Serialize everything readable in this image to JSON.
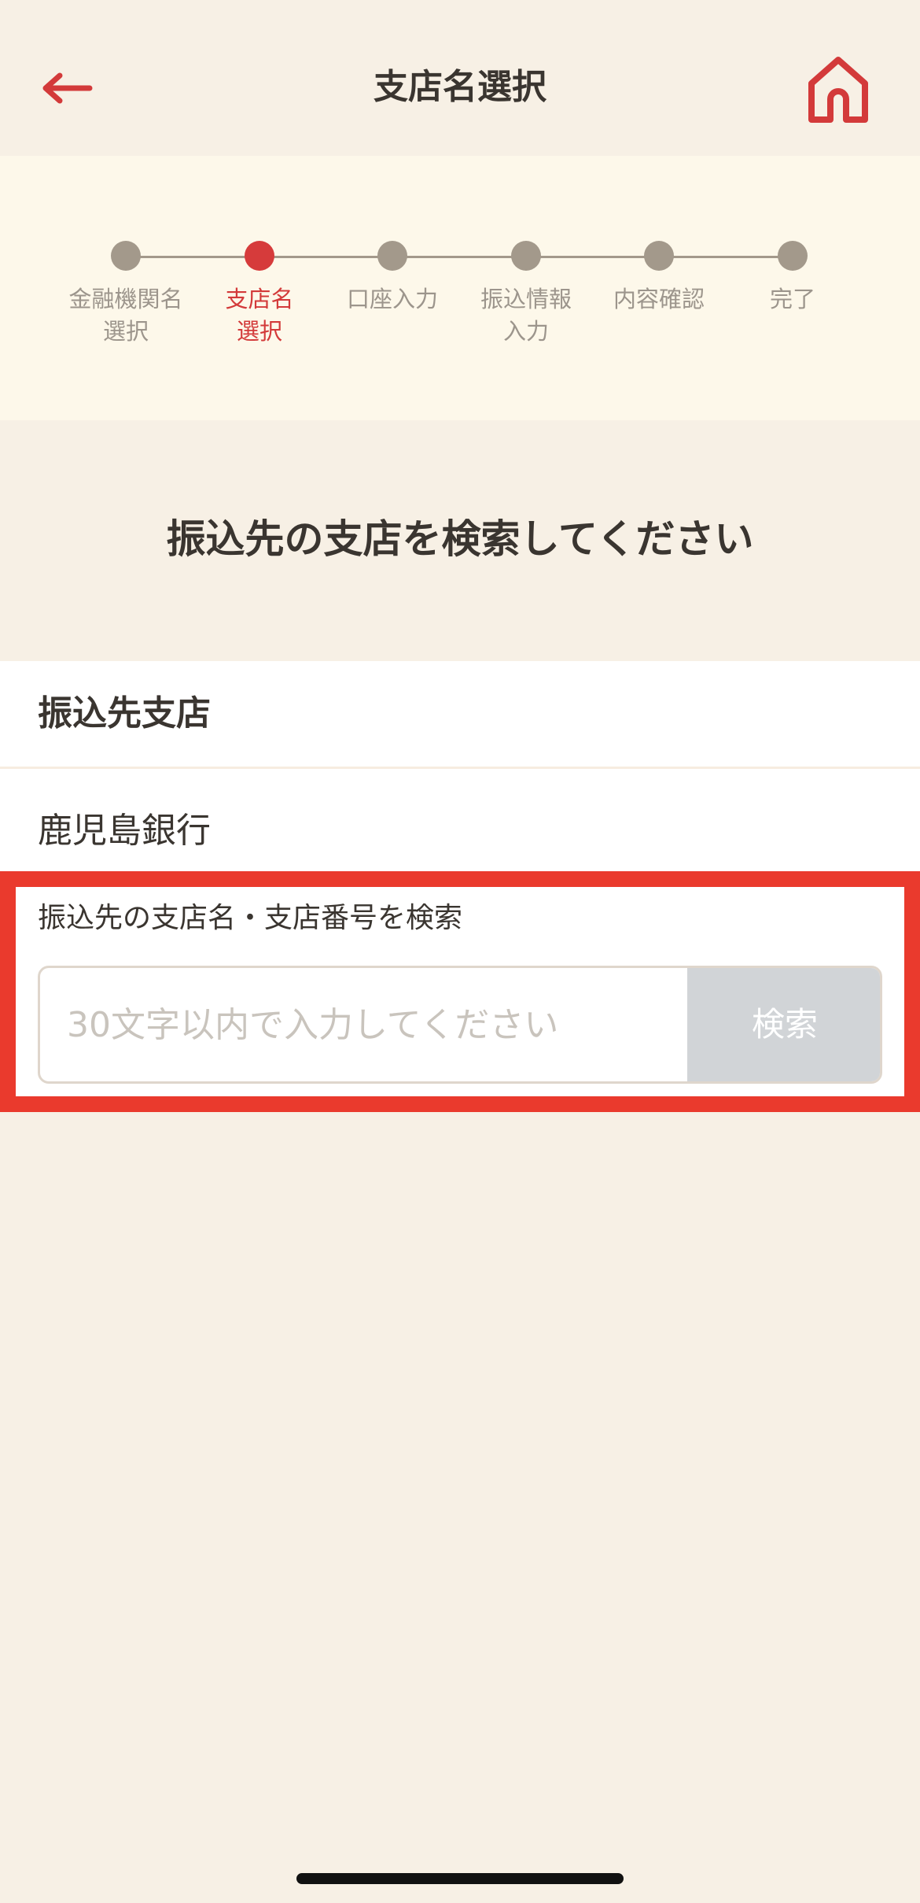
{
  "header": {
    "title": "支店名選択",
    "back_icon": "arrow-left-icon",
    "home_icon": "home-icon",
    "accent_color": "#d33a3a"
  },
  "stepper": {
    "steps": [
      {
        "label": "金融機関名\n選択",
        "state": "done"
      },
      {
        "label": "支店名\n選択",
        "state": "current"
      },
      {
        "label": "口座入力",
        "state": "pending"
      },
      {
        "label": "振込情報\n入力",
        "state": "pending"
      },
      {
        "label": "内容確認",
        "state": "pending"
      },
      {
        "label": "完了",
        "state": "pending"
      }
    ]
  },
  "main": {
    "instruction": "振込先の支店を検索してください",
    "section_title": "振込先支店",
    "bank_name": "鹿児島銀行",
    "search": {
      "label": "振込先の支店名・支店番号を検索",
      "placeholder": "30文字以内で入力してください",
      "value": "",
      "button_label": "検索"
    }
  }
}
